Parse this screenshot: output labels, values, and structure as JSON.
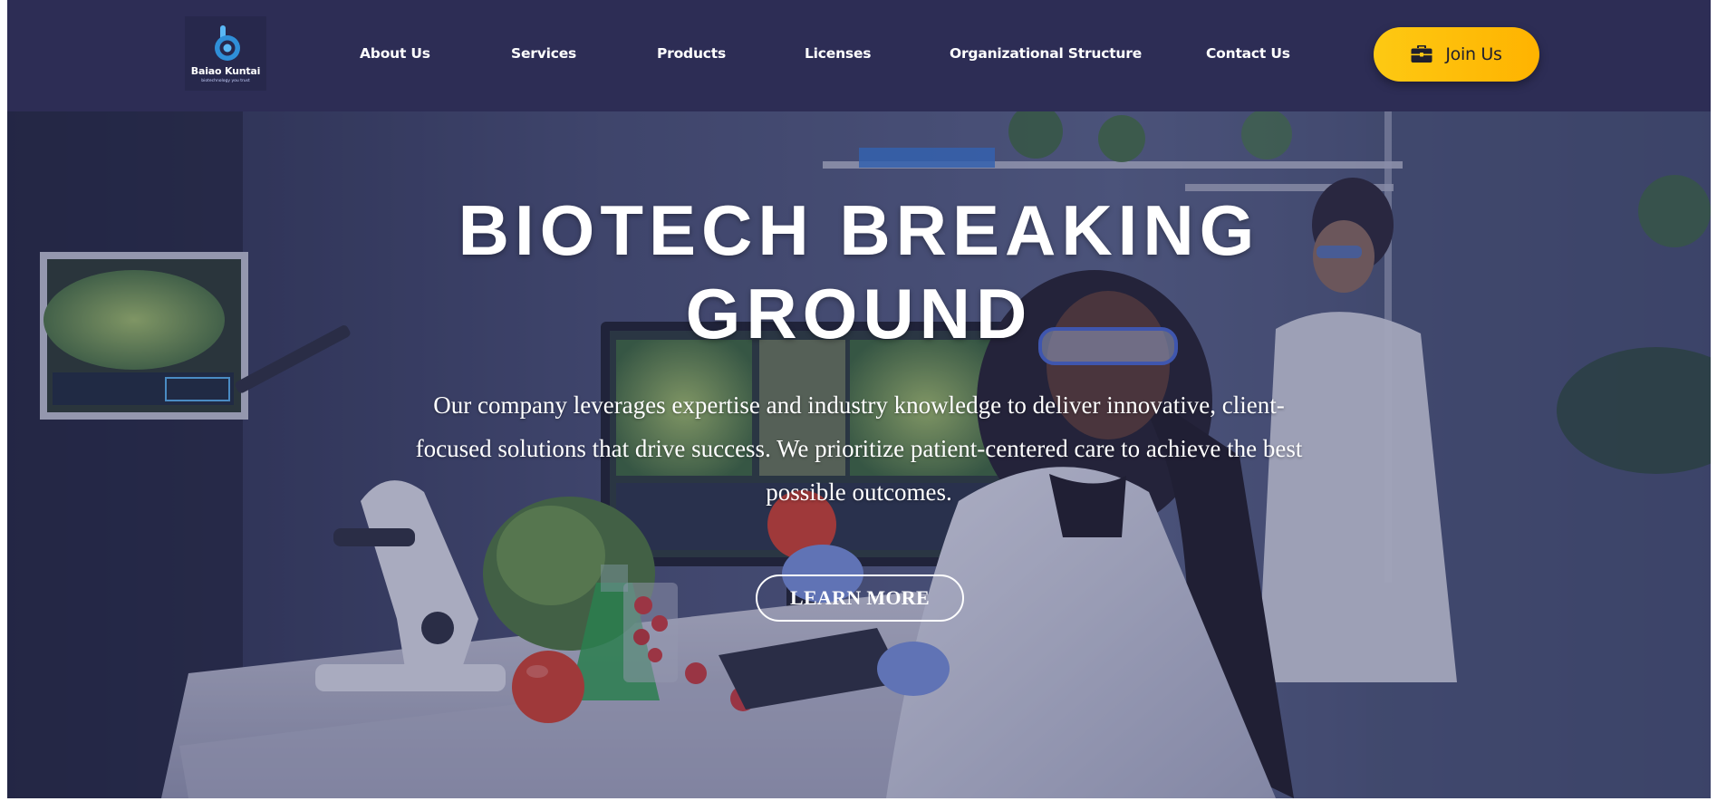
{
  "brand": {
    "name": "Baiao Kuntai",
    "tagline": "biotechnology you trust",
    "accent_color": "#2f8fd8"
  },
  "nav": {
    "items": [
      {
        "label": "About Us"
      },
      {
        "label": "Services"
      },
      {
        "label": "Products"
      },
      {
        "label": "Licenses"
      },
      {
        "label": "Organizational Structure"
      },
      {
        "label": "Contact Us"
      }
    ],
    "cta_label": "Join Us",
    "cta_icon": "briefcase-icon",
    "header_color": "#2d2d55",
    "cta_color": "#fdc913"
  },
  "hero": {
    "title_line1": "BIOTECH BREAKING",
    "title_line2": "GROUND",
    "description": "Our company leverages expertise and industry knowledge to deliver innovative, client-focused solutions that drive success. We prioritize patient-centered care to achieve the best possible outcomes.",
    "button_label": "LEARN MORE"
  }
}
